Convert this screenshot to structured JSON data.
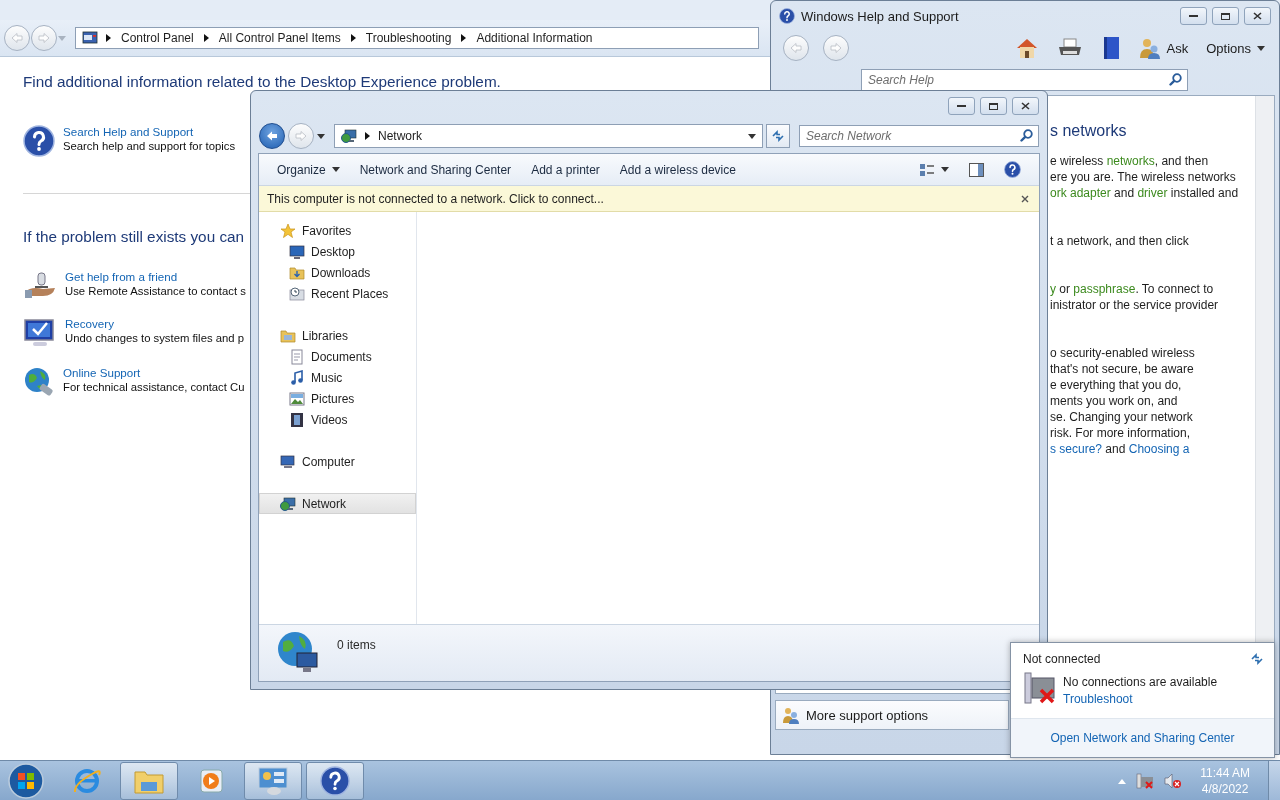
{
  "control_panel": {
    "breadcrumb": [
      "Control Panel",
      "All Control Panel Items",
      "Troubleshooting",
      "Additional Information"
    ],
    "heading": "Find additional information related to the Desktop Experience problem.",
    "help_item": {
      "title": "Search Help and Support",
      "description": "Search help and support for topics"
    },
    "subheading": "If the problem still exists you can",
    "items": [
      {
        "kind": "friend",
        "title": "Get help from a friend",
        "description": "Use Remote Assistance to contact s"
      },
      {
        "kind": "recovery",
        "title": "Recovery",
        "description": "Undo changes to system files and p"
      },
      {
        "kind": "online",
        "title": "Online Support",
        "description": "For technical assistance, contact Cu"
      }
    ]
  },
  "help_window": {
    "title": "Windows Help and Support",
    "ask": "Ask",
    "options": "Options",
    "search": {
      "placeholder": "Search Help"
    },
    "heading": "s networks",
    "paragraphs": [
      [
        [
          {
            "kind": "text",
            "text": "e wireless "
          },
          {
            "kind": "term",
            "text": "networks"
          },
          {
            "kind": "text",
            "text": ", and then"
          }
        ],
        [
          {
            "kind": "text",
            "text": "ere you are. The wireless networks"
          }
        ],
        [
          {
            "kind": "term",
            "text": "ork adapter"
          },
          {
            "kind": "text",
            "text": " and "
          },
          {
            "kind": "term",
            "text": "driver"
          },
          {
            "kind": "text",
            "text": " installed and"
          }
        ]
      ],
      [
        [
          {
            "kind": "text",
            "text": "t a network, and then click"
          }
        ]
      ],
      [
        [
          {
            "kind": "term",
            "text": "y"
          },
          {
            "kind": "text",
            "text": " or "
          },
          {
            "kind": "term",
            "text": "passphrase"
          },
          {
            "kind": "text",
            "text": ". To connect to"
          }
        ],
        [
          {
            "kind": "text",
            "text": "inistrator or the service provider"
          }
        ]
      ],
      [
        [
          {
            "kind": "text",
            "text": "o security-enabled wireless"
          }
        ],
        [
          {
            "kind": "text",
            "text": "that's not secure, be aware"
          }
        ],
        [
          {
            "kind": "text",
            "text": "e everything that you do,"
          }
        ],
        [
          {
            "kind": "text",
            "text": "ments you work on, and"
          }
        ],
        [
          {
            "kind": "text",
            "text": "se. Changing your network"
          }
        ],
        [
          {
            "kind": "text",
            "text": "risk. For more information,"
          }
        ],
        [
          {
            "kind": "link",
            "text": "s secure?"
          },
          {
            "kind": "text",
            "text": " and "
          },
          {
            "kind": "link",
            "text": "Choosing a"
          }
        ]
      ]
    ],
    "footer": "More support options"
  },
  "network_window": {
    "address": "Network",
    "search": {
      "placeholder": "Search Network"
    },
    "commands": [
      {
        "kind": "menu",
        "label": "Organize"
      },
      {
        "kind": "action",
        "label": "Network and Sharing Center"
      },
      {
        "kind": "action",
        "label": "Add a printer"
      },
      {
        "kind": "action",
        "label": "Add a wireless device"
      }
    ],
    "info_bar": "This computer is not connected to a network. Click to connect...",
    "nav": [
      {
        "kind": "favorites",
        "label": "Favorites",
        "selected": false,
        "children": [
          {
            "kind": "desktop",
            "label": "Desktop",
            "selected": false
          },
          {
            "kind": "downloads",
            "label": "Downloads",
            "selected": false
          },
          {
            "kind": "recent",
            "label": "Recent Places",
            "selected": false
          }
        ]
      },
      {
        "kind": "libraries",
        "label": "Libraries",
        "selected": false,
        "children": [
          {
            "kind": "documents",
            "label": "Documents",
            "selected": false
          },
          {
            "kind": "music",
            "label": "Music",
            "selected": false
          },
          {
            "kind": "pictures",
            "label": "Pictures",
            "selected": false
          },
          {
            "kind": "videos",
            "label": "Videos",
            "selected": false
          }
        ]
      },
      {
        "kind": "computer",
        "label": "Computer",
        "selected": false
      },
      {
        "kind": "network",
        "label": "Network",
        "selected": true
      }
    ],
    "status": "0 items"
  },
  "network_popup": {
    "status": "Not connected",
    "message": "No connections are available",
    "troubleshoot": "Troubleshoot",
    "link": "Open Network and Sharing Center"
  },
  "taskbar": {
    "apps": [
      {
        "kind": "ie",
        "active": false
      },
      {
        "kind": "explorer",
        "active": true
      },
      {
        "kind": "media",
        "active": false
      },
      {
        "kind": "control",
        "active": true
      },
      {
        "kind": "help",
        "active": true
      }
    ],
    "time": "11:44 AM",
    "date": "4/8/2022"
  }
}
